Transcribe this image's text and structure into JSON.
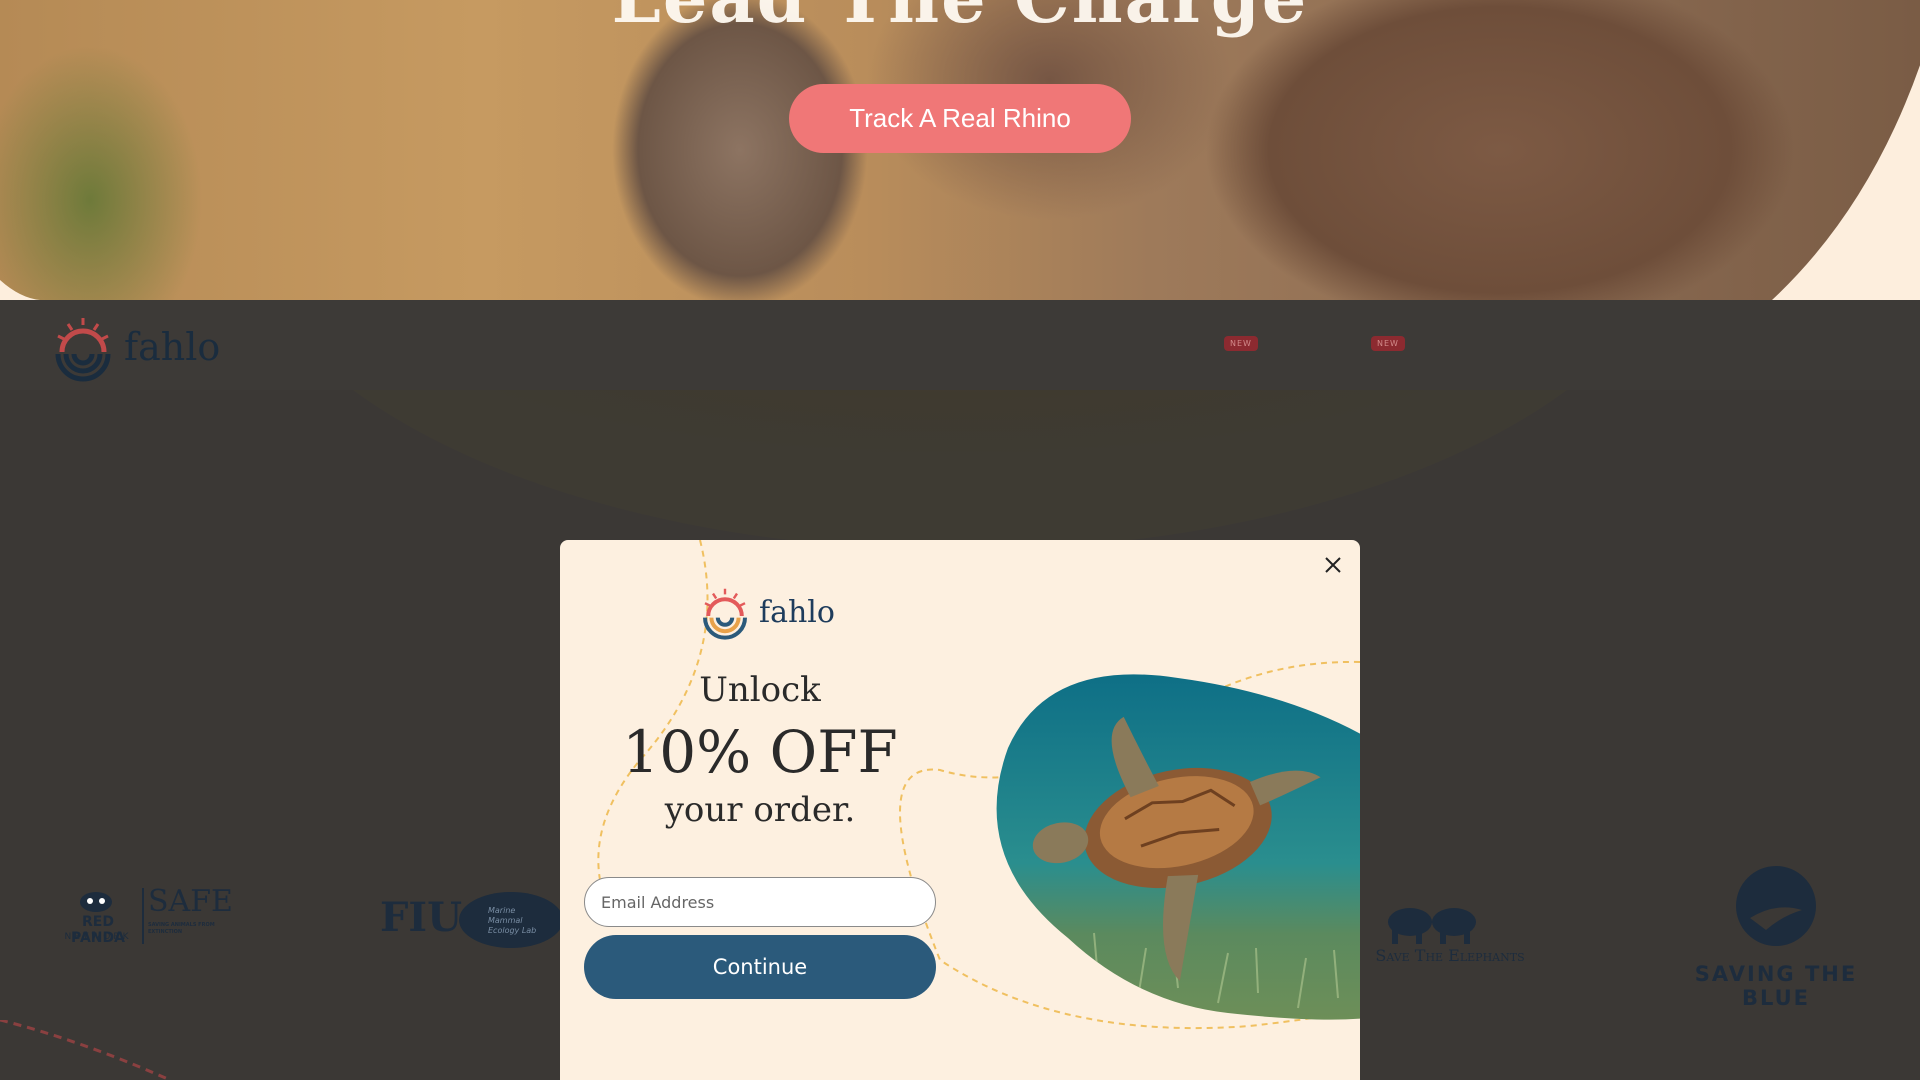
{
  "hero": {
    "title": "Lead The Charge",
    "cta_label": "Track A Real Rhino"
  },
  "nav": {
    "brand": "fahlo",
    "badges": [
      "NEW",
      "NEW"
    ]
  },
  "partners": [
    {
      "name": "RED PANDA",
      "sub": "NETWORK",
      "extra": "SAFE",
      "extra_sub": "SAVING ANIMALS FROM EXTINCTION"
    },
    {
      "name": "FIU",
      "sub": "Marine Mammal Ecology Lab"
    },
    {
      "name": "Save The Elephants"
    },
    {
      "name": "SAVING THE BLUE"
    }
  ],
  "modal": {
    "brand": "fahlo",
    "line1": "Unlock",
    "line2": "10% OFF",
    "line3": "your order.",
    "email_placeholder": "Email Address",
    "continue_label": "Continue"
  },
  "colors": {
    "accent_pink": "#f07777",
    "brand_navy": "#2b5a7b",
    "modal_bg": "#fdf0e0",
    "nav_bg": "#3d3a37"
  }
}
